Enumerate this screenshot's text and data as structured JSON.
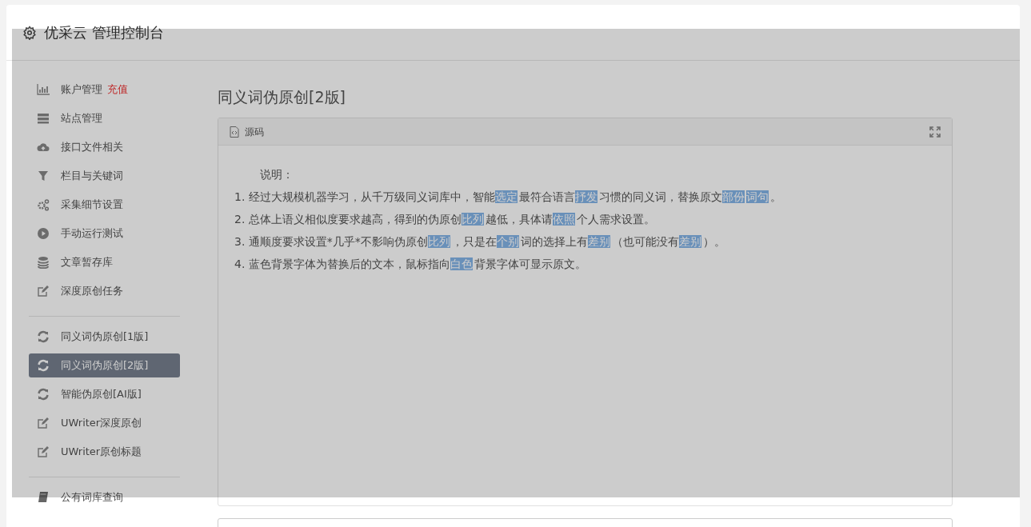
{
  "header": {
    "title": "优采云 管理控制台"
  },
  "sidebar": {
    "groups": [
      {
        "items": [
          {
            "label": "账户管理",
            "badge": "充值",
            "selected": false
          },
          {
            "label": "站点管理",
            "selected": false
          },
          {
            "label": "接口文件相关",
            "selected": false
          },
          {
            "label": "栏目与关键词",
            "selected": false
          },
          {
            "label": "采集细节设置",
            "selected": false
          },
          {
            "label": "手动运行测试",
            "selected": false
          },
          {
            "label": "文章暂存库",
            "selected": false
          },
          {
            "label": "深度原创任务",
            "selected": false
          }
        ]
      },
      {
        "items": [
          {
            "label": "同义词伪原创[1版]",
            "selected": false
          },
          {
            "label": "同义词伪原创[2版]",
            "selected": true
          },
          {
            "label": "智能伪原创[AI版]",
            "selected": false
          },
          {
            "label": "UWriter深度原创",
            "selected": false
          },
          {
            "label": "UWriter原创标题",
            "selected": false
          }
        ]
      },
      {
        "items": [
          {
            "label": "公有词库查询",
            "selected": false
          }
        ]
      }
    ]
  },
  "main": {
    "heading": "同义词伪原创[2版]",
    "panel": {
      "title": "源码",
      "intro": "说明：",
      "lines": [
        [
          {
            "text": "1. 经过大规模机器学习，从千万级同义词库中，智能",
            "highlighted": false
          },
          {
            "text": "选定",
            "highlighted": true
          },
          {
            "text": "最符合语言",
            "highlighted": false
          },
          {
            "text": "抒发",
            "highlighted": true
          },
          {
            "text": "习惯的同义词，替换原文",
            "highlighted": false
          },
          {
            "text": "部份",
            "highlighted": true
          },
          {
            "text": "词句",
            "highlighted": true
          },
          {
            "text": "。",
            "highlighted": false
          }
        ],
        [
          {
            "text": "2. 总体上语义相似度要求越高，得到的伪原创",
            "highlighted": false
          },
          {
            "text": "比列",
            "highlighted": true
          },
          {
            "text": "越低，具体请",
            "highlighted": false
          },
          {
            "text": "依照",
            "highlighted": true
          },
          {
            "text": "个人需求设置。",
            "highlighted": false
          }
        ],
        [
          {
            "text": "3. 通顺度要求设置*几乎*不影响伪原创",
            "highlighted": false
          },
          {
            "text": "比列",
            "highlighted": true
          },
          {
            "text": "，只是在",
            "highlighted": false
          },
          {
            "text": "个别",
            "highlighted": true
          },
          {
            "text": "词的选择上有",
            "highlighted": false
          },
          {
            "text": "差别",
            "highlighted": true
          },
          {
            "text": "（也可能没有",
            "highlighted": false
          },
          {
            "text": "差别",
            "highlighted": true
          },
          {
            "text": "）。",
            "highlighted": false
          }
        ],
        [
          {
            "text": "4. 蓝色背景字体为替换后的文本，鼠标指向",
            "highlighted": false
          },
          {
            "text": "白色",
            "highlighted": true
          },
          {
            "text": "背景字体可显示原文。",
            "highlighted": false
          }
        ]
      ]
    }
  },
  "overlay": {
    "shown": true
  }
}
